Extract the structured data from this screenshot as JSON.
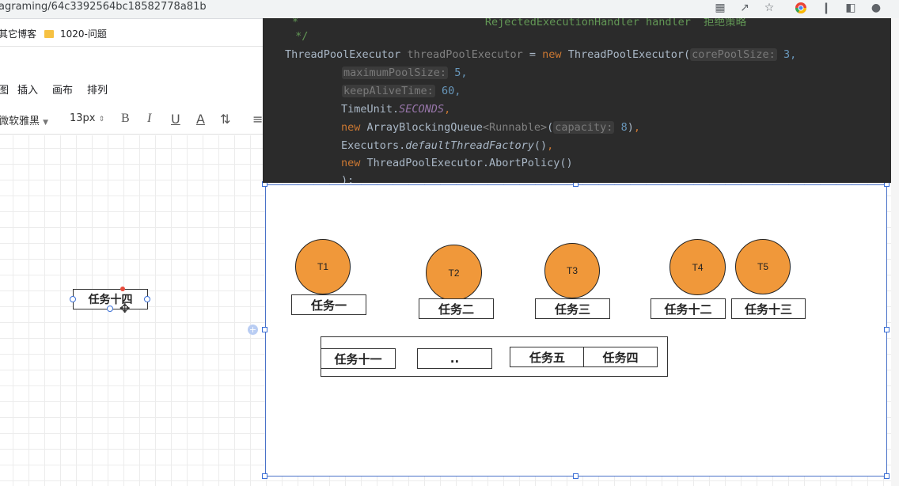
{
  "browser": {
    "url_fragment": "agraming/64c3392564bc18582778a81b",
    "bookmarks": [
      "其它博客",
      "1020-问题"
    ]
  },
  "menu": {
    "items": [
      "图",
      "插入",
      "画布",
      "排列"
    ]
  },
  "format_toolbar": {
    "font_family": "微软雅黑",
    "font_size": "13px"
  },
  "code": {
    "lines": [
      "*                             RejectedExecutionHandler handler  拒绝策略",
      " */"
    ],
    "decl_type": "ThreadPoolExecutor",
    "decl_var": "threadPoolExecutor",
    "kw_new": "new",
    "ctor": "ThreadPoolExecutor(",
    "hint_core": "corePoolSize:",
    "val_core": "3,",
    "hint_max": "maximumPoolSize:",
    "val_max": "5,",
    "hint_keep": "keepAliveTime:",
    "val_keep": "60,",
    "timeunit": "TimeUnit.",
    "seconds": "SECONDS",
    "queue_ctor": "ArrayBlockingQueue",
    "queue_generic": "<Runnable>",
    "hint_cap": "capacity:",
    "val_cap": "8",
    "executors": "Executors.",
    "factory": "defaultThreadFactory",
    "policy": "ThreadPoolExecutor.AbortPolicy()",
    "close": ");"
  },
  "diagram": {
    "floating_task": "任务十四",
    "threads": [
      "T1",
      "T2",
      "T3",
      "T4",
      "T5"
    ],
    "running_tasks": [
      "任务一",
      "任务二",
      "任务三",
      "任务十二",
      "任务十三"
    ],
    "queue_tasks": [
      "任务十一",
      "..",
      "任务五",
      "任务四"
    ]
  }
}
